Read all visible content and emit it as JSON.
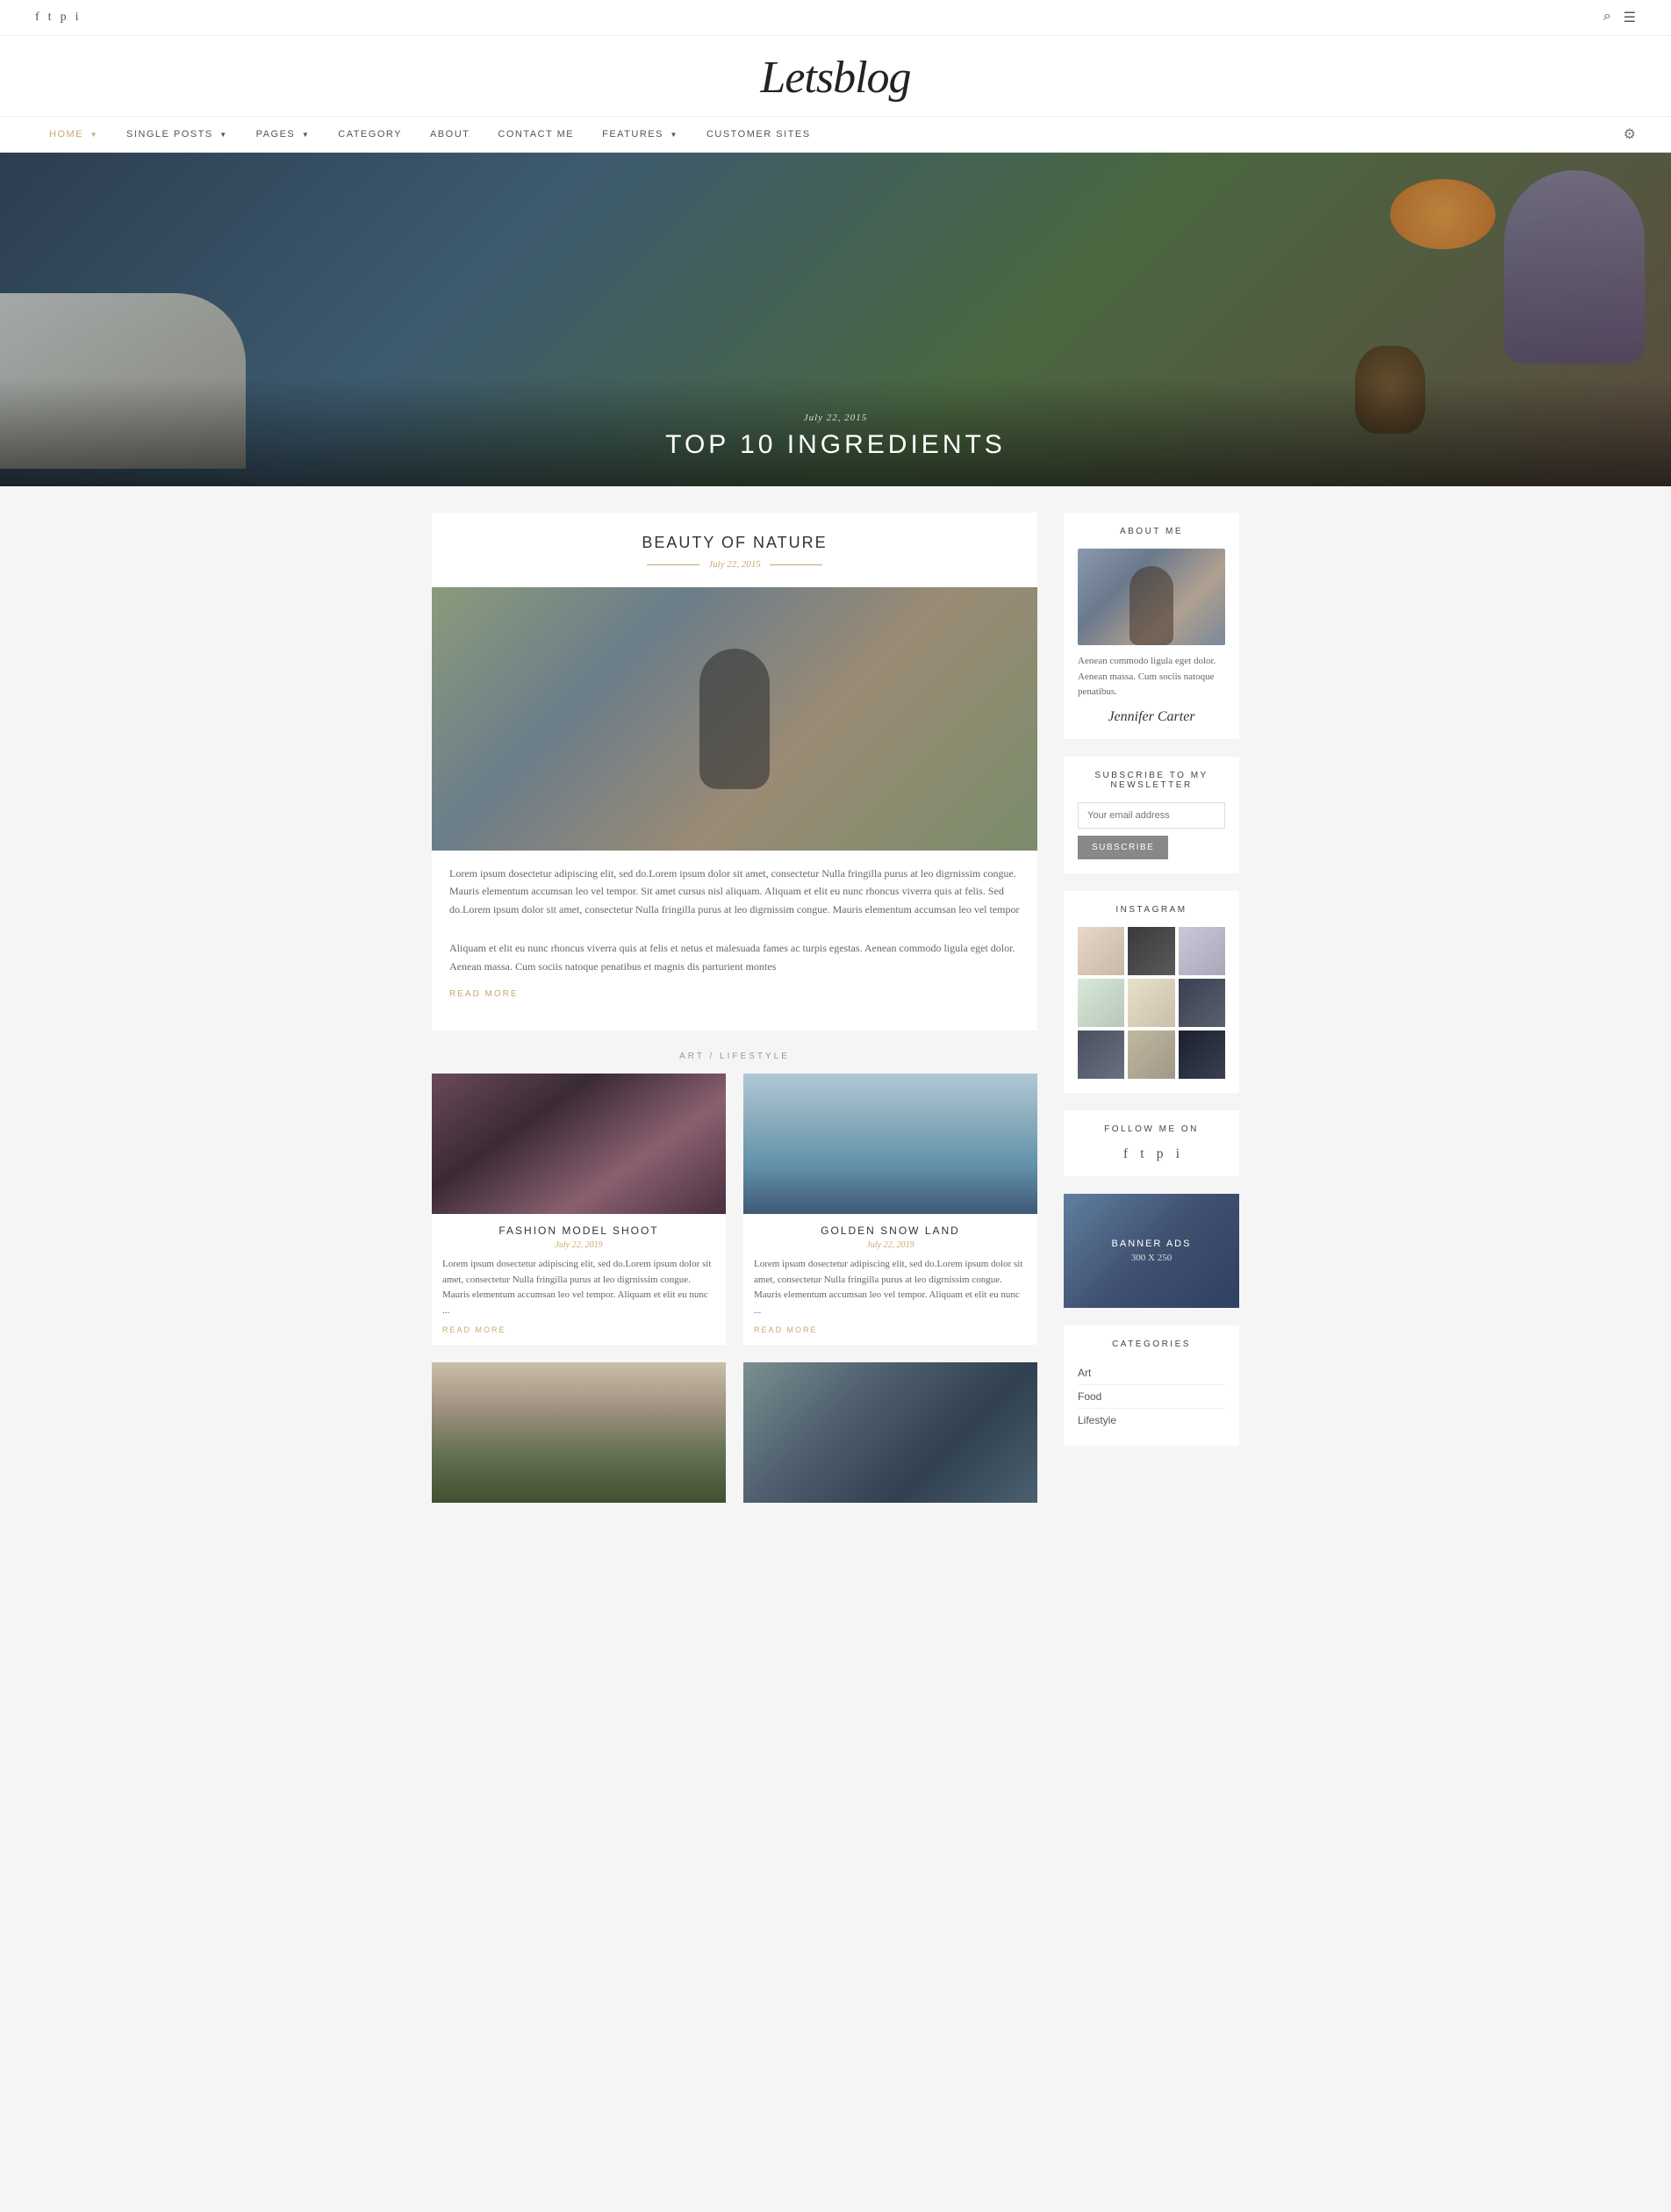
{
  "topbar": {
    "social_icons": [
      "f",
      "t",
      "p",
      "i"
    ],
    "right_icons": [
      "search",
      "menu"
    ]
  },
  "logo": {
    "text": "Letsblog"
  },
  "nav": {
    "items": [
      {
        "label": "HOME",
        "has_arrow": true,
        "active": true
      },
      {
        "label": "SINGLE POSTS",
        "has_arrow": true
      },
      {
        "label": "PAGES",
        "has_arrow": true
      },
      {
        "label": "CATEGORY",
        "has_arrow": false
      },
      {
        "label": "ABOUT",
        "has_arrow": false
      },
      {
        "label": "CONTACT ME",
        "has_arrow": false
      },
      {
        "label": "FEATURES",
        "has_arrow": true
      },
      {
        "label": "CUSTOMER SITES",
        "has_arrow": false
      }
    ]
  },
  "hero": {
    "date": "July 22, 2015",
    "title": "TOP 10 INGREDIENTS"
  },
  "featured_post": {
    "title": "BEAUTY OF NATURE",
    "date": "July 22, 2015",
    "excerpt1": "Lorem ipsum dosectetur adipiscing elit, sed do.Lorem ipsum dolor sit amet, consectetur Nulla fringilla purus at leo digrnissim congue. Mauris elementum accumsan leo vel tempor. Sit amet cursus nisl aliquam. Aliquam et elit eu nunc rhoncus viverra quis at felis. Sed do.Lorem ipsum dolor sit amet, consectetur Nulla fringilla purus at leo digrnissim congue. Mauris elementum accumsan leo vel tempor",
    "excerpt2": "Aliquam et elit eu nunc rhoncus viverra quis at felis et netus et malesuada fames ac turpis egestas. Aenean commodo ligula eget dolor. Aenean massa. Cum sociis natoque penatibus et magnis dis parturient montes",
    "read_more": "READ MORE",
    "section_label": "ART / LIFESTYLE"
  },
  "grid_posts": [
    {
      "title": "FASHION MODEL SHOOT",
      "date": "July 22, 2019",
      "excerpt": "Lorem ipsum dosectetur adipiscing elit, sed do.Lorem ipsum dolor sit amet, consectetur Nulla fringilla purus at leo digrnissim congue. Mauris elementum accumsan leo vel tempor. Aliquam et elit eu nunc ...",
      "read_more": "READ MORE",
      "img_class": "img-fashion"
    },
    {
      "title": "GOLDEN SNOW LAND",
      "date": "July 22, 2019",
      "excerpt": "Lorem ipsum dosectetur adipiscing elit, sed do.Lorem ipsum dolor sit amet, consectetur Nulla fringilla purus at leo digrnissim congue. Mauris elementum accumsan leo vel tempor. Aliquam et elit eu nunc ...",
      "read_more": "READ MORE",
      "img_class": "img-snow"
    },
    {
      "title": "",
      "date": "",
      "excerpt": "",
      "read_more": "",
      "img_class": "img-trees1"
    },
    {
      "title": "",
      "date": "",
      "excerpt": "",
      "read_more": "",
      "img_class": "img-rocks"
    }
  ],
  "sidebar": {
    "about": {
      "title": "ABOUT ME",
      "text": "Aenean commodo ligula eget dolor. Aenean massa. Cum sociis natoque penatibus.",
      "signature": "Jennifer Carter"
    },
    "newsletter": {
      "title": "SUBSCRIBE TO MY NEWSLETTER",
      "placeholder": "Your email address",
      "button": "SUBSCRIBE"
    },
    "instagram": {
      "title": "INSTAGRAM"
    },
    "follow": {
      "title": "FOLLOW ME ON",
      "icons": [
        "f",
        "t",
        "p",
        "i"
      ]
    },
    "banner": {
      "text": "BANNER ADS",
      "size": "300 X 250"
    },
    "categories": {
      "title": "CATEGORIES",
      "items": [
        "Art",
        "Food",
        "Lifestyle"
      ]
    }
  }
}
